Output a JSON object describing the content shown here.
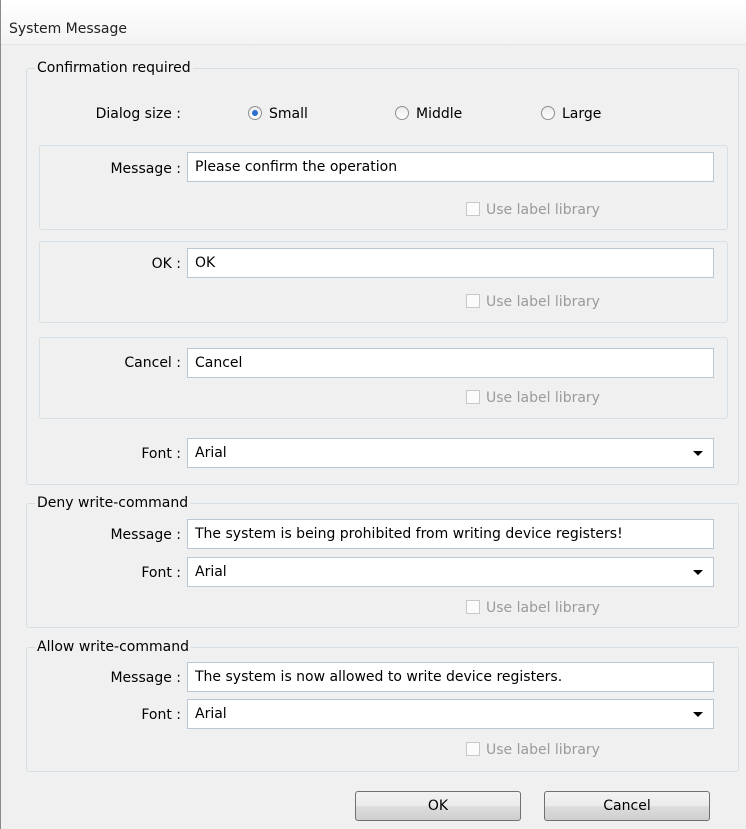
{
  "window": {
    "title": "System Message"
  },
  "confirmation": {
    "legend": "Confirmation required",
    "dialog_size_label": "Dialog size :",
    "size_options": [
      {
        "label": "Small",
        "selected": true
      },
      {
        "label": "Middle",
        "selected": false
      },
      {
        "label": "Large",
        "selected": false
      }
    ],
    "message": {
      "label": "Message :",
      "value": "Please confirm the operation",
      "use_label_library": "Use label library",
      "use_label_library_checked": false
    },
    "ok": {
      "label": "OK :",
      "value": "OK",
      "use_label_library": "Use label library",
      "use_label_library_checked": false
    },
    "cancel": {
      "label": "Cancel :",
      "value": "Cancel",
      "use_label_library": "Use label library",
      "use_label_library_checked": false
    },
    "font": {
      "label": "Font :",
      "value": "Arial"
    }
  },
  "deny": {
    "legend": "Deny write-command",
    "message_label": "Message :",
    "message_value": "The system is being prohibited from writing device registers!",
    "font_label": "Font :",
    "font_value": "Arial",
    "use_label_library": "Use label library"
  },
  "allow": {
    "legend": "Allow write-command",
    "message_label": "Message :",
    "message_value": "The system is now allowed to write device registers.",
    "font_label": "Font :",
    "font_value": "Arial",
    "use_label_library": "Use label library"
  },
  "buttons": {
    "ok": "OK",
    "cancel": "Cancel"
  }
}
